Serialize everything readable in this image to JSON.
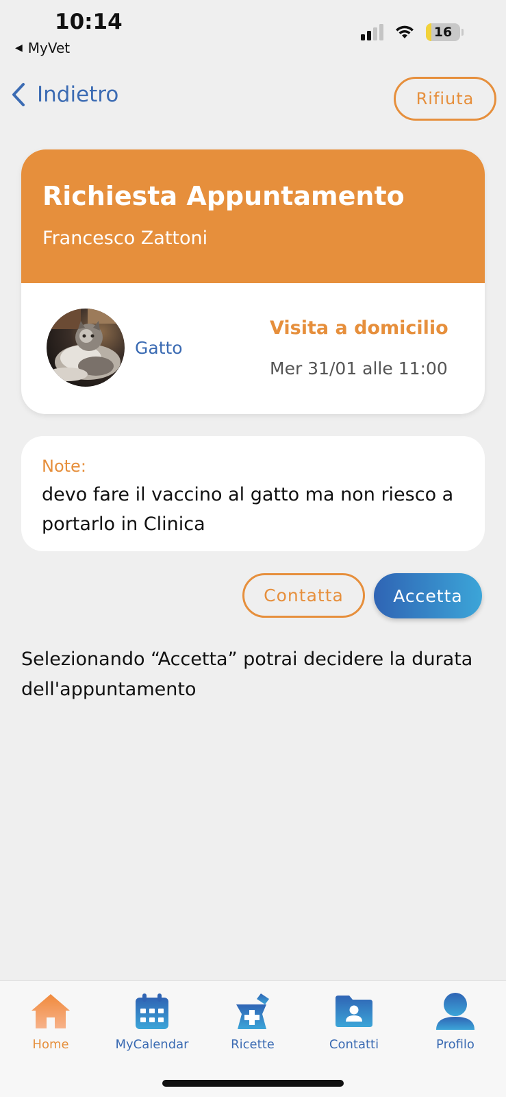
{
  "status_bar": {
    "time": "10:14",
    "back_app": "MyVet",
    "battery": "16",
    "battery_level": 0.16,
    "signal_icon": "signal-icon",
    "wifi_icon": "wifi-icon"
  },
  "nav": {
    "back_label": "Indietro",
    "reject_label": "Rifiuta"
  },
  "appointment": {
    "title": "Richiesta Appuntamento",
    "client_name": "Francesco Zattoni",
    "pet_type": "Gatto",
    "visit_type": "Visita a domicilio",
    "date_time": "Mer 31/01 alle 11:00"
  },
  "notes": {
    "label": "Note:",
    "text": "devo fare il vaccino al gatto ma non riesco a portarlo in Clinica"
  },
  "actions": {
    "contact_label": "Contatta",
    "accept_label": "Accetta"
  },
  "hint": "Selezionando “Accetta” potrai decidere la durata dell'appuntamento",
  "tabs": [
    {
      "label": "Home",
      "icon": "home-icon",
      "active": true
    },
    {
      "label": "MyCalendar",
      "icon": "calendar-icon",
      "active": false
    },
    {
      "label": "Ricette",
      "icon": "prescription-icon",
      "active": false
    },
    {
      "label": "Contatti",
      "icon": "contacts-folder-icon",
      "active": false
    },
    {
      "label": "Profilo",
      "icon": "profile-icon",
      "active": false
    }
  ],
  "colors": {
    "accent_orange": "#e68f3c",
    "accent_blue": "#3b6bb3",
    "background": "#efefef"
  }
}
